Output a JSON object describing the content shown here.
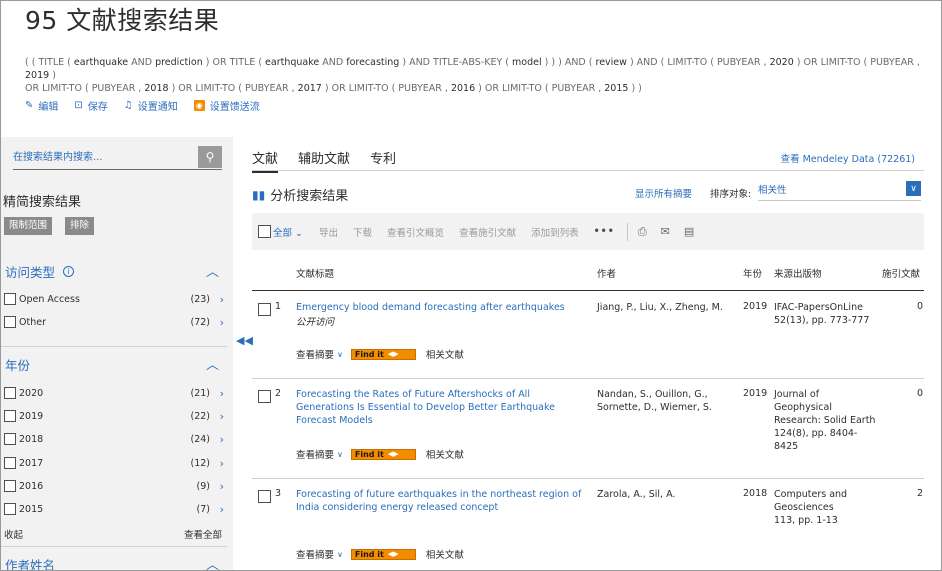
{
  "page": {
    "title": "95 文献搜索结果",
    "query_line1": [
      {
        "t": "( ( TITLE ( ",
        "k": false
      },
      {
        "t": "earthquake",
        "k": true
      },
      {
        "t": " AND ",
        "k": false
      },
      {
        "t": "prediction",
        "k": true
      },
      {
        "t": " ) OR TITLE ( ",
        "k": false
      },
      {
        "t": "earthquake",
        "k": true
      },
      {
        "t": " AND ",
        "k": false
      },
      {
        "t": "forecasting",
        "k": true
      },
      {
        "t": " ) AND TITLE-ABS-KEY ( ",
        "k": false
      },
      {
        "t": "model",
        "k": true
      },
      {
        "t": " ) ) ) AND ( ",
        "k": false
      },
      {
        "t": "review",
        "k": true
      },
      {
        "t": " ) AND ( LIMIT-TO ( PUBYEAR , ",
        "k": false
      },
      {
        "t": "2020",
        "k": true
      },
      {
        "t": " ) OR LIMIT-TO ( PUBYEAR , ",
        "k": false
      },
      {
        "t": "2019",
        "k": true
      },
      {
        "t": " )",
        "k": false
      }
    ],
    "query_line2": [
      {
        "t": "OR LIMIT-TO ( PUBYEAR , ",
        "k": false
      },
      {
        "t": "2018",
        "k": true
      },
      {
        "t": " ) OR LIMIT-TO ( PUBYEAR , ",
        "k": false
      },
      {
        "t": "2017",
        "k": true
      },
      {
        "t": " ) OR LIMIT-TO ( PUBYEAR , ",
        "k": false
      },
      {
        "t": "2016",
        "k": true
      },
      {
        "t": " ) OR LIMIT-TO ( PUBYEAR , ",
        "k": false
      },
      {
        "t": "2015",
        "k": true
      },
      {
        "t": " ) )",
        "k": false
      }
    ]
  },
  "actions": {
    "edit": "编辑",
    "save": "保存",
    "alert": "设置通知",
    "feed": "设置馈送流",
    "edit_icon": "pencil-icon",
    "save_icon": "save-icon",
    "alert_icon": "bell-icon",
    "feed_icon": "rss-icon"
  },
  "sidebar": {
    "search_placeholder": "在搜索结果内搜索...",
    "search_icon": "magnifier-icon",
    "refine_title": "精简搜索结果",
    "limit_label": "限制范围",
    "exclude_label": "排除",
    "access_title": "访问类型",
    "access_items": [
      {
        "label": "Open Access",
        "count": "(23)"
      },
      {
        "label": "Other",
        "count": "(72)"
      }
    ],
    "year_title": "年份",
    "year_items": [
      {
        "label": "2020",
        "count": "(21)"
      },
      {
        "label": "2019",
        "count": "(22)"
      },
      {
        "label": "2018",
        "count": "(24)"
      },
      {
        "label": "2017",
        "count": "(12)"
      },
      {
        "label": "2016",
        "count": "(9)"
      },
      {
        "label": "2015",
        "count": "(7)"
      }
    ],
    "collapse_label": "收起",
    "view_all_label": "查看全部",
    "author_title": "作者姓名"
  },
  "tabs": {
    "items": [
      "文献",
      "辅助文献",
      "专利"
    ],
    "mendeley": "查看 Mendeley Data (72261)"
  },
  "results_bar": {
    "analyze": "分析搜索结果",
    "show_all_abstracts": "显示所有摘要",
    "sort_label": "排序对象:",
    "sort_value": "相关性"
  },
  "toolbar": {
    "all": "全部",
    "export": "导出",
    "download": "下载",
    "citation_overview": "查看引文概览",
    "cited_by": "查看施引文献",
    "add_to_list": "添加到列表",
    "more": "•••"
  },
  "table": {
    "headers": {
      "title": "文献标题",
      "authors": "作者",
      "year": "年份",
      "source": "来源出版物",
      "cited": "施引文献"
    },
    "row_actions": {
      "abstract": "查看摘要",
      "findit": "Find it",
      "related": "相关文献"
    },
    "rows": [
      {
        "num": "1",
        "title": "Emergency blood demand forecasting after earthquakes",
        "oa": "公开访问",
        "authors": "Jiang, P., Liu, X., Zheng, M.",
        "year": "2019",
        "source": "IFAC-PapersOnLine\n52(13), pp. 773-777",
        "cited": "0"
      },
      {
        "num": "2",
        "title": "Forecasting the Rates of Future Aftershocks of All Generations Is Essential to Develop Better Earthquake Forecast Models",
        "oa": "",
        "authors": "Nandan, S., Ouillon, G., Sornette, D., Wiemer, S.",
        "year": "2019",
        "source": "Journal of Geophysical Research: Solid Earth\n124(8), pp. 8404-8425",
        "cited": "0"
      },
      {
        "num": "3",
        "title": "Forecasting of future earthquakes in the northeast region of India considering energy released concept",
        "oa": "",
        "authors": "Zarola, A., Sil, A.",
        "year": "2018",
        "source": "Computers and Geosciences\n113, pp. 1-13",
        "cited": "2"
      }
    ]
  }
}
